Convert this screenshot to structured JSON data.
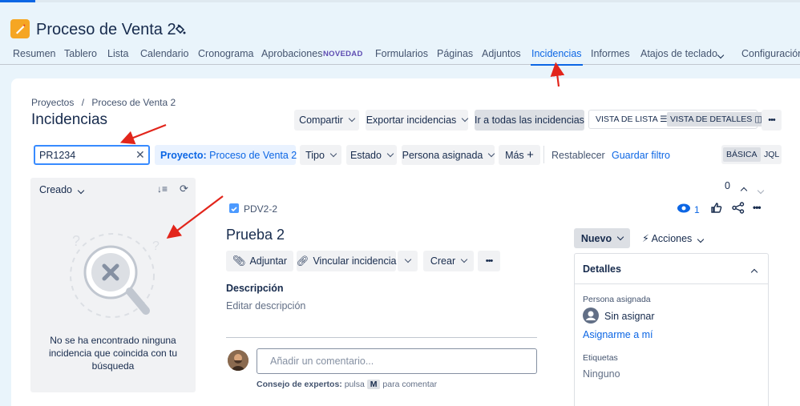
{
  "project": {
    "title": "Proceso de Venta 2"
  },
  "tabs": [
    {
      "label": "Resumen"
    },
    {
      "label": "Tablero"
    },
    {
      "label": "Lista"
    },
    {
      "label": "Calendario"
    },
    {
      "label": "Cronograma"
    },
    {
      "label": "Aprobaciones"
    },
    {
      "label": "Formularios"
    },
    {
      "label": "Páginas"
    },
    {
      "label": "Adjuntos"
    },
    {
      "label": "Incidencias"
    },
    {
      "label": "Informes"
    },
    {
      "label": "Atajos de teclado"
    },
    {
      "label": "Configuración d"
    }
  ],
  "badge_new": "NOVEDAD",
  "breadcrumb": {
    "projects": "Proyectos",
    "sep": "/",
    "project": "Proceso de Venta 2"
  },
  "page_title": "Incidencias",
  "toolbar": {
    "share": "Compartir",
    "export": "Exportar incidencias",
    "all_issues": "Ir a todas las incidencias",
    "list_view": "VISTA DE LISTA",
    "detail_view": "VISTA DE DETALLES",
    "more": "•••"
  },
  "filters": {
    "search_value": "PR1234",
    "project_label": "Proyecto:",
    "project_value": "Proceso de Venta 2",
    "type": "Tipo",
    "status": "Estado",
    "assignee": "Persona asignada",
    "more": "Más",
    "reset": "Restablecer",
    "save": "Guardar filtro",
    "basic": "BÁSICA",
    "jql": "JQL"
  },
  "list": {
    "sort_label": "Creado",
    "empty_message": "No se ha encontrado ninguna incidencia que coincida con tu búsqueda"
  },
  "pager": {
    "count": "0"
  },
  "issue": {
    "key": "PDV2-2",
    "watchers": "1",
    "title": "Prueba 2",
    "attach": "Adjuntar",
    "link": "Vincular incidencia",
    "create": "Crear",
    "description_label": "Descripción",
    "description_placeholder": "Editar descripción",
    "comment_placeholder": "Añadir un comentario...",
    "tip_label": "Consejo de expertos:",
    "tip_text_pre": "pulsa",
    "tip_key": "M",
    "tip_text_post": "para comentar"
  },
  "sidebar": {
    "status": "Nuevo",
    "actions": "Acciones",
    "details_title": "Detalles",
    "assignee_label": "Persona asignada",
    "assignee_value": "Sin asignar",
    "assign_me": "Asignarme a mí",
    "labels_label": "Etiquetas",
    "labels_value": "Ninguno"
  },
  "colors": {
    "accent": "#0c66e4",
    "project_icon": "#f5a623",
    "annotation_arrow": "#e2251b"
  }
}
